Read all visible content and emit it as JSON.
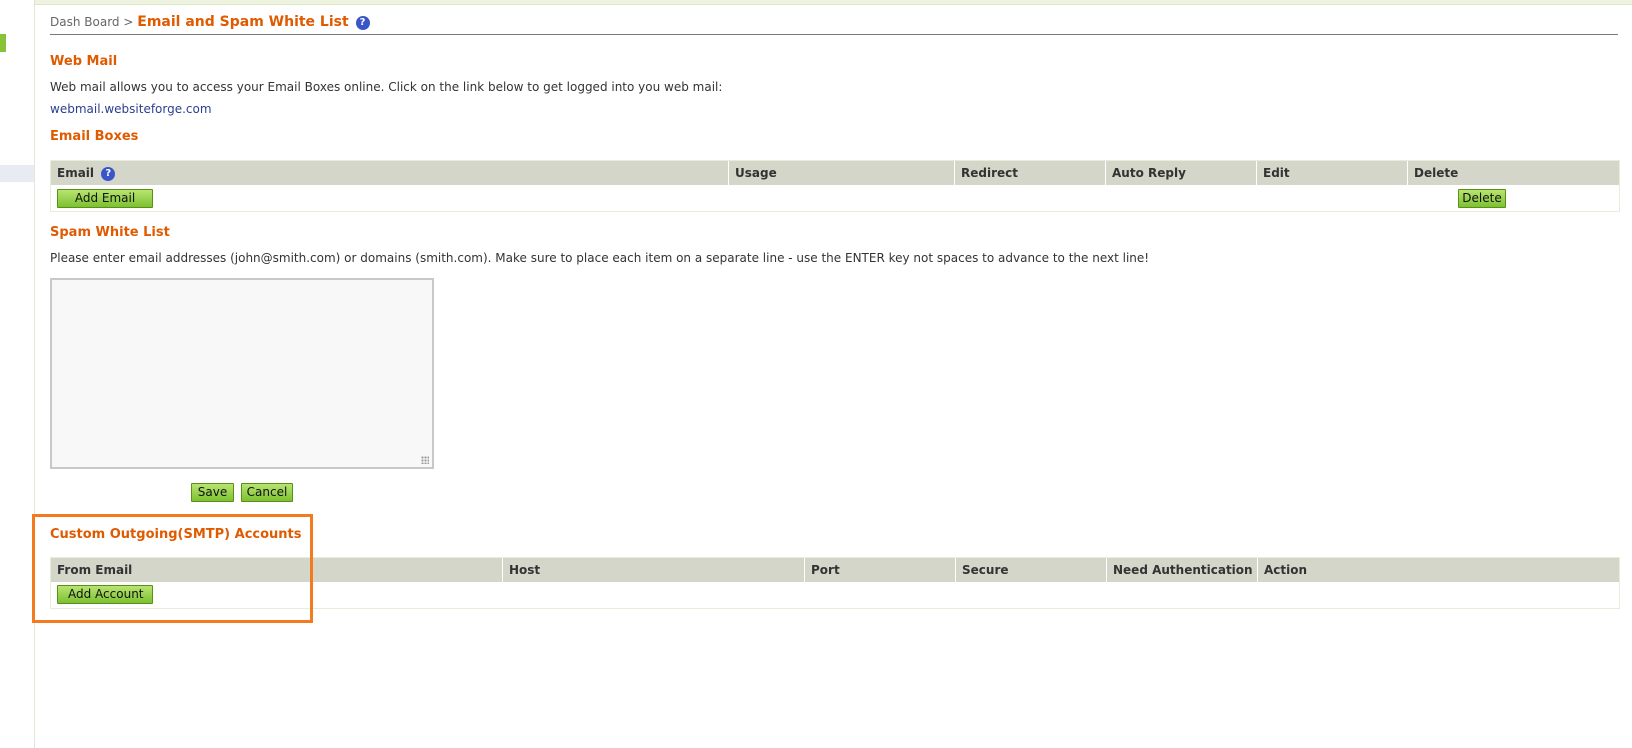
{
  "breadcrumb": {
    "parent": "Dash Board",
    "separator": ">",
    "current": "Email and Spam White List",
    "help_glyph": "?"
  },
  "webmail": {
    "title": "Web Mail",
    "description": "Web mail allows you to access your Email Boxes online. Click on the link below to get logged into you web mail:",
    "link": "webmail.websiteforge.com"
  },
  "email_boxes": {
    "title": "Email Boxes",
    "columns": [
      "Email",
      "Usage",
      "Redirect",
      "Auto Reply",
      "Edit",
      "Delete"
    ],
    "email_help_glyph": "?",
    "add_label": "Add Email",
    "delete_label": "Delete"
  },
  "spam": {
    "title": "Spam White List",
    "description": "Please enter email addresses (john@smith.com) or domains (smith.com). Make sure to place each item on a separate line - use the ENTER key not spaces to advance to the next line!",
    "value": "",
    "save_label": "Save",
    "cancel_label": "Cancel"
  },
  "smtp": {
    "title": "Custom Outgoing(SMTP) Accounts",
    "columns": [
      "From Email",
      "Host",
      "Port",
      "Secure",
      "Need Authentication",
      "Action"
    ],
    "add_label": "Add Account"
  },
  "colors": {
    "accent": "#e05a00",
    "button_green": "#86c336",
    "highlight": "#f37a1f",
    "header_bg": "#d4d6c9",
    "link": "#2a3f8f"
  }
}
